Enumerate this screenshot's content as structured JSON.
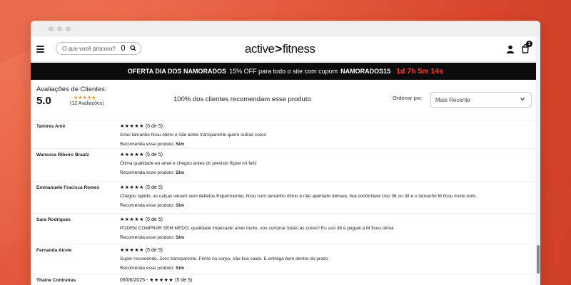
{
  "header": {
    "search_placeholder": "O que você procura?",
    "logo_left": "active",
    "logo_arrow": ">",
    "logo_right": "fitness",
    "cart_count": "1"
  },
  "promo": {
    "bold_prefix": "OFERTA DIA DOS NAMORADOS",
    "text": "15% OFF para todo o site com cupom",
    "coupon": "NAMORADOS15",
    "timer": "1d 7h 5m 14s"
  },
  "summary": {
    "title": "Avaliações de Clientes:",
    "score": "5.0",
    "stars": "★★★★★",
    "count": "(12 Avaliações)",
    "recommend_text": "100% dos clientes recomendam esse produto",
    "sort_label": "Ordenar por:",
    "sort_value": "Mais Recente"
  },
  "reviews": [
    {
      "name": "Tamires Amir",
      "date": "",
      "stars": "★★★★★",
      "rating": "(5 de 5)",
      "text": "Amei tamanho ficou ótimo e não achei transparente quero outras cores",
      "rec_label": "Recomenda esse produto:",
      "rec_value": "Sim"
    },
    {
      "name": "Wanessa Ribeiro Braatz",
      "date": "",
      "stars": "★★★★★",
      "rating": "(5 de 5)",
      "text": "Ótima qualidade eu amei e chegou antes do previsto fiquei mt feliz",
      "rec_label": "Recomenda esse produto:",
      "rec_value": "Sim"
    },
    {
      "name": "Emmanuele Fracisca Romes",
      "date": "",
      "stars": "★★★★★",
      "rating": "(5 de 5)",
      "text": "Chegou rápido, as calças vieram sem defeitos Experimentei, ficou num tamanho ótimo e não apertado demais, fica confortável Uso 36 ou 38 e o tamanho M ficou muito bom.",
      "rec_label": "Recomenda esse produto:",
      "rec_value": "Sim"
    },
    {
      "name": "Sara Rodrigues",
      "date": "",
      "stars": "★★★★★",
      "rating": "(5 de 5)",
      "text": "PODEM COMPRAR SEM MEDO, qualidade impecavel amei muito, vou comprar todas as cores!! Eu uso 38 e peguei a M ficou otima",
      "rec_label": "Recomenda esse produto:",
      "rec_value": "Sim"
    },
    {
      "name": "Fernanda Atrele",
      "date": "",
      "stars": "★★★★★",
      "rating": "(5 de 5)",
      "text": "Super recomendo. Zero transparente. Firme no corpo, não fica caido. E entrega bem dentro do prazo",
      "rec_label": "Recomenda esse produto:",
      "rec_value": "Sim"
    },
    {
      "name": "Thaine Contreiras",
      "date": "05/06/2025",
      "stars": "★★★★★",
      "rating": "(5 de 5)",
      "text": "",
      "rec_label": "",
      "rec_value": ""
    }
  ]
}
